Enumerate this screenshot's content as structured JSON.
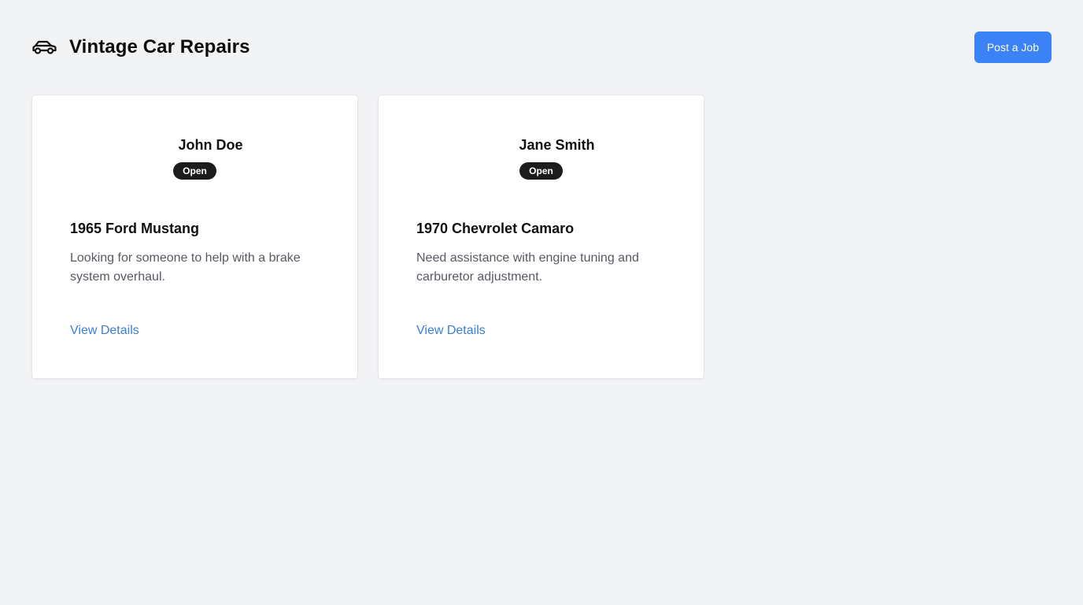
{
  "header": {
    "title": "Vintage Car Repairs",
    "icon": "car-icon",
    "post_button_label": "Post a Job"
  },
  "colors": {
    "accent": "#3b82f6",
    "link": "#3b7fd6",
    "badge": "#1c1c1c",
    "background": "#f2f3f5"
  },
  "jobs": [
    {
      "owner": "John Doe",
      "status": "Open",
      "title": "1965 Ford Mustang",
      "description": "Looking for someone to help with a brake system overhaul.",
      "link_label": "View Details"
    },
    {
      "owner": "Jane Smith",
      "status": "Open",
      "title": "1970 Chevrolet Camaro",
      "description": "Need assistance with engine tuning and carburetor adjustment.",
      "link_label": "View Details"
    }
  ]
}
